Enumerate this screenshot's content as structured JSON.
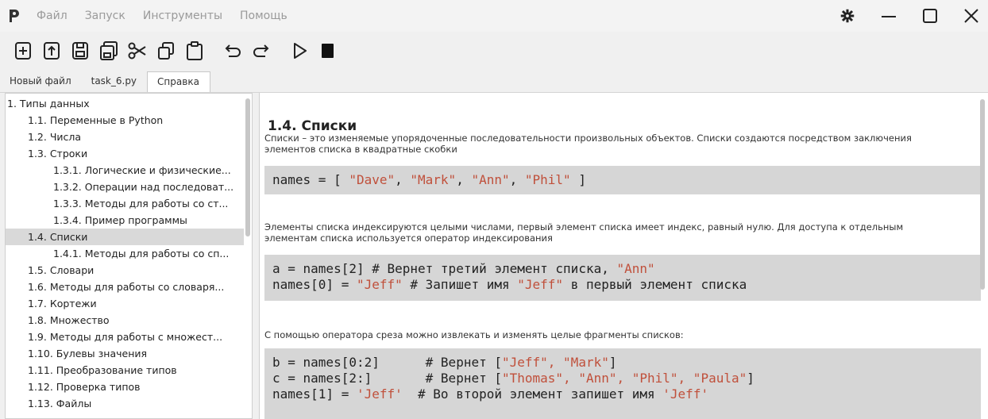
{
  "menu": {
    "items": [
      "Файл",
      "Запуск",
      "Инструменты",
      "Помощь"
    ]
  },
  "tabs": [
    "Новый файл",
    "task_6.py",
    "Справка"
  ],
  "tree": {
    "items": [
      "1. Типы данных",
      "1.1. Переменные в Python",
      "1.2. Числа",
      "1.3. Строки",
      "1.3.1. Логические и физические...",
      "1.3.2. Операции над последоват...",
      "1.3.3. Методы для работы со ст...",
      "1.3.4. Пример программы",
      "1.4. Списки",
      "1.4.1. Методы для работы со сп...",
      "1.5. Словари",
      "1.6. Методы для работы со словаря...",
      "1.7. Кортежи",
      "1.8. Множество",
      "1.9. Методы для работы с множест...",
      "1.10. Булевы значения",
      "1.11. Преобразование типов",
      "1.12. Проверка типов",
      "1.13. Файлы"
    ],
    "selected": "1.4. Списки"
  },
  "content": {
    "heading": "1.4. Списки",
    "para1_line1": "Списки – это изменяемые упорядоченные последовательности произвольных объектов. Списки создаются посредством заключения",
    "para1_line2": "элементов списка в квадратные скобки",
    "code1": {
      "a": "names = [ ",
      "s1": "\"Dave\"",
      "c1": ", ",
      "s2": "\"Mark\"",
      "c2": ", ",
      "s3": "\"Ann\"",
      "c3": ", ",
      "s4": "\"Phil\"",
      "end": " ]"
    },
    "para2_line1": "Элементы списка индексируются целыми числами, первый элемент списка имеет индекс, равный нулю. Для доступа к отдельным",
    "para2_line2": "элементам списка используется оператор индексирования",
    "code2": {
      "l1a": "a = names[2] # Вернет третий элемент списка, ",
      "l1s": "\"Ann\"",
      "l2a": "names[0] = ",
      "l2s1": "\"Jeff\"",
      "l2b": " # Запишет имя ",
      "l2s2": "\"Jeff\"",
      "l2c": " в первый элемент списка"
    },
    "para3": "С помощью оператора среза можно извлекать и изменять целые фрагменты списков:",
    "code3": {
      "l1a": "b = names[0:2]      # Вернет [",
      "l1s": "\"Jeff\", \"Mark\"",
      "l1e": "]",
      "l2a": "c = names[2:]       # Вернет [",
      "l2s": "\"Thomas\", \"Ann\", \"Phil\", \"Paula\"",
      "l2e": "]",
      "l3a": "names[1] = ",
      "l3s1": "'Jeff'",
      "l3b": "  # Во второй элемент запишет имя ",
      "l3s2": "'Jeff'"
    }
  }
}
